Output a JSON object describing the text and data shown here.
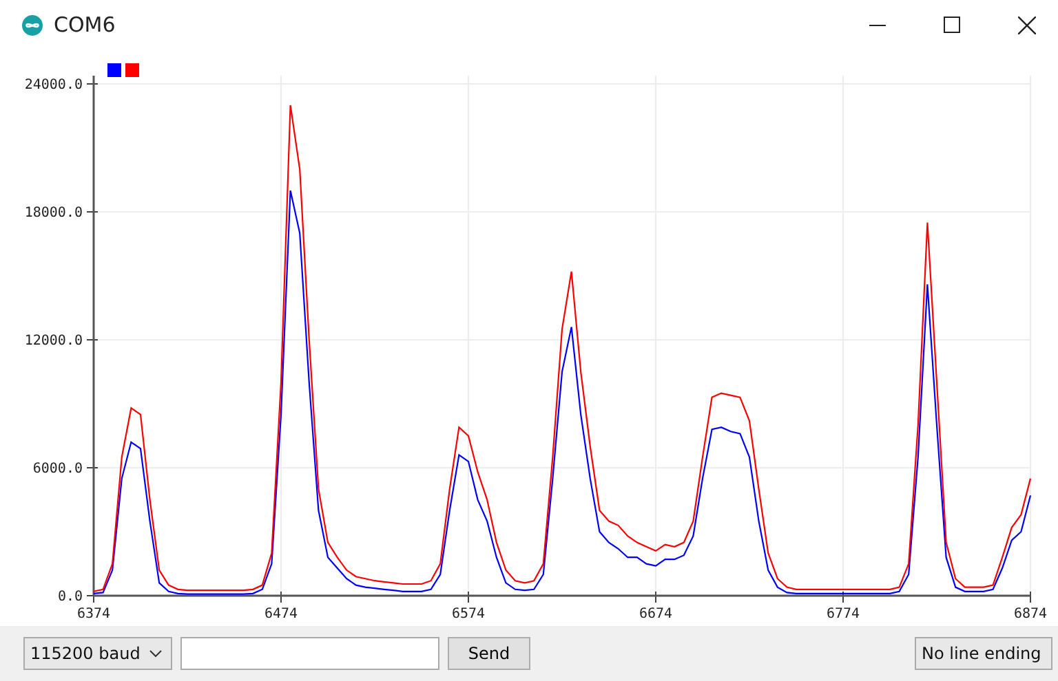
{
  "window": {
    "title": "COM6"
  },
  "plotter": {
    "chart_data": {
      "type": "line",
      "x": [
        6374,
        6379,
        6384,
        6389,
        6394,
        6399,
        6404,
        6409,
        6414,
        6419,
        6424,
        6429,
        6434,
        6439,
        6444,
        6449,
        6454,
        6459,
        6464,
        6469,
        6474,
        6479,
        6484,
        6489,
        6494,
        6499,
        6504,
        6509,
        6514,
        6519,
        6524,
        6529,
        6534,
        6539,
        6544,
        6549,
        6554,
        6559,
        6564,
        6569,
        6574,
        6579,
        6584,
        6589,
        6594,
        6599,
        6604,
        6609,
        6614,
        6619,
        6624,
        6629,
        6634,
        6639,
        6644,
        6649,
        6654,
        6659,
        6664,
        6669,
        6674,
        6679,
        6684,
        6689,
        6694,
        6699,
        6704,
        6709,
        6714,
        6719,
        6724,
        6729,
        6734,
        6739,
        6744,
        6749,
        6754,
        6759,
        6764,
        6769,
        6774,
        6779,
        6784,
        6789,
        6794,
        6799,
        6804,
        6809,
        6814,
        6819,
        6824,
        6829,
        6834,
        6839,
        6844,
        6849,
        6854,
        6859,
        6864,
        6869,
        6874
      ],
      "series": [
        {
          "color": "#0000ff",
          "values": [
            100,
            150,
            1200,
            5500,
            7200,
            6900,
            3500,
            600,
            200,
            100,
            80,
            80,
            80,
            80,
            80,
            80,
            80,
            100,
            300,
            1500,
            8500,
            19000,
            17000,
            10000,
            4000,
            1800,
            1300,
            800,
            500,
            400,
            350,
            300,
            250,
            200,
            200,
            200,
            300,
            1000,
            4000,
            6600,
            6300,
            4500,
            3500,
            1800,
            600,
            300,
            250,
            300,
            1000,
            5500,
            10500,
            12600,
            8500,
            5500,
            3000,
            2500,
            2200,
            1800,
            1800,
            1500,
            1400,
            1700,
            1700,
            1900,
            2800,
            5500,
            7800,
            7900,
            7700,
            7600,
            6500,
            3500,
            1200,
            400,
            150,
            100,
            100,
            100,
            100,
            100,
            100,
            100,
            100,
            100,
            100,
            100,
            200,
            1000,
            6500,
            14600,
            8000,
            1800,
            400,
            200,
            200,
            200,
            300,
            1300,
            2600,
            3000,
            4700
          ]
        },
        {
          "color": "#ff0000",
          "values": [
            200,
            300,
            1500,
            6500,
            8800,
            8500,
            4500,
            1200,
            500,
            300,
            250,
            250,
            250,
            250,
            250,
            250,
            250,
            300,
            500,
            2000,
            10000,
            23000,
            20000,
            12000,
            5000,
            2500,
            1800,
            1200,
            900,
            800,
            700,
            650,
            600,
            550,
            550,
            550,
            700,
            1500,
            5000,
            7900,
            7500,
            5800,
            4500,
            2500,
            1200,
            700,
            600,
            700,
            1500,
            6500,
            12500,
            15200,
            10500,
            7000,
            4000,
            3500,
            3300,
            2800,
            2500,
            2300,
            2100,
            2400,
            2300,
            2500,
            3500,
            6500,
            9300,
            9500,
            9400,
            9300,
            8200,
            5000,
            2000,
            800,
            400,
            300,
            300,
            300,
            300,
            300,
            300,
            300,
            300,
            300,
            300,
            300,
            400,
            1500,
            8000,
            17500,
            10000,
            2500,
            800,
            400,
            400,
            400,
            500,
            1800,
            3200,
            3800,
            5500
          ]
        }
      ],
      "xlim": [
        6374,
        6874
      ],
      "ylim": [
        0,
        24000
      ],
      "grid": true,
      "xticks": [
        6374,
        6474,
        6574,
        6674,
        6774,
        6874
      ],
      "yticks": [
        {
          "value": 0,
          "label": "0.0"
        },
        {
          "value": 6000,
          "label": "6000.0"
        },
        {
          "value": 12000,
          "label": "12000.0"
        },
        {
          "value": 18000,
          "label": "18000.0"
        },
        {
          "value": 24000,
          "label": "24000.0"
        }
      ]
    }
  },
  "controls": {
    "baud": "115200 baud",
    "send": "Send",
    "line_ending": "No line ending"
  }
}
